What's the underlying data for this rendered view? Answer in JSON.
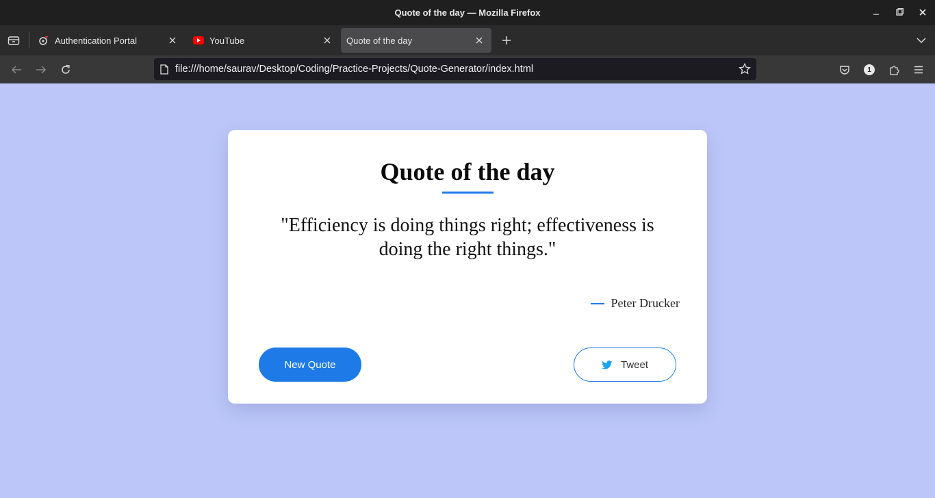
{
  "window": {
    "title": "Quote of the day — Mozilla Firefox"
  },
  "tabs": [
    {
      "label": "Authentication Portal",
      "icon": "auth-portal-favicon"
    },
    {
      "label": "YouTube",
      "icon": "youtube-favicon"
    },
    {
      "label": "Quote of the day",
      "icon": "none",
      "active": true
    }
  ],
  "navbar": {
    "url": "file:///home/saurav/Desktop/Coding/Practice-Projects/Quote-Generator/index.html",
    "extension_badge": "1"
  },
  "page": {
    "background": "#bcc6f8",
    "accent": "#1e7ae6",
    "heading": "Quote of the day",
    "quote": "\"Efficiency is doing things right; effectiveness is doing the right things.\"",
    "author": "Peter Drucker",
    "new_quote_label": "New Quote",
    "tweet_label": "Tweet"
  }
}
